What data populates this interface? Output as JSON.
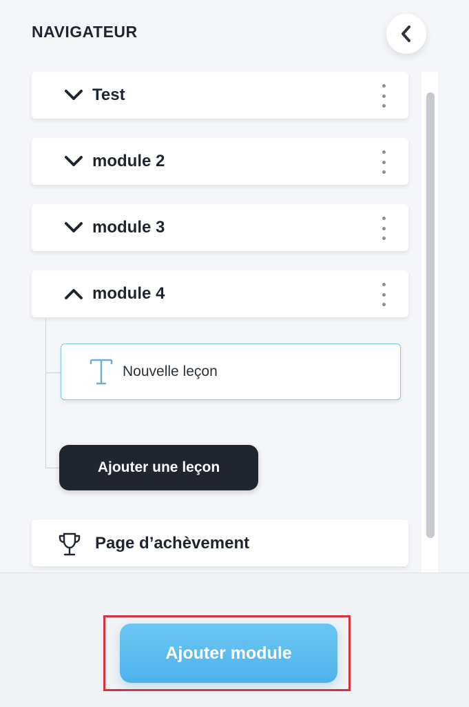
{
  "header": {
    "title": "NAVIGATEUR",
    "back_icon": "chevron-left-icon"
  },
  "modules": [
    {
      "label": "Test",
      "expanded": false,
      "chevron_icon": "chevron-down-icon",
      "menu_icon": "kebab-menu-icon"
    },
    {
      "label": "module 2",
      "expanded": false,
      "chevron_icon": "chevron-down-icon",
      "menu_icon": "kebab-menu-icon"
    },
    {
      "label": "module 3",
      "expanded": false,
      "chevron_icon": "chevron-down-icon",
      "menu_icon": "kebab-menu-icon"
    },
    {
      "label": "module 4",
      "expanded": true,
      "chevron_icon": "chevron-up-icon",
      "menu_icon": "kebab-menu-icon"
    }
  ],
  "lessons": [
    {
      "label": "Nouvelle leçon",
      "icon": "text-icon"
    }
  ],
  "add_lesson_label": "Ajouter une leçon",
  "completion_page": {
    "label": "Page d’achèvement",
    "icon": "trophy-icon"
  },
  "footer": {
    "add_module_label": "Ajouter module"
  },
  "colors": {
    "background": "#f4f6f9",
    "card": "#ffffff",
    "text": "#1f2530",
    "dark_button": "#1f2630",
    "accent": "#5bbcf0",
    "lesson_border": "#7fc3e6",
    "highlight": "#d9313c"
  }
}
